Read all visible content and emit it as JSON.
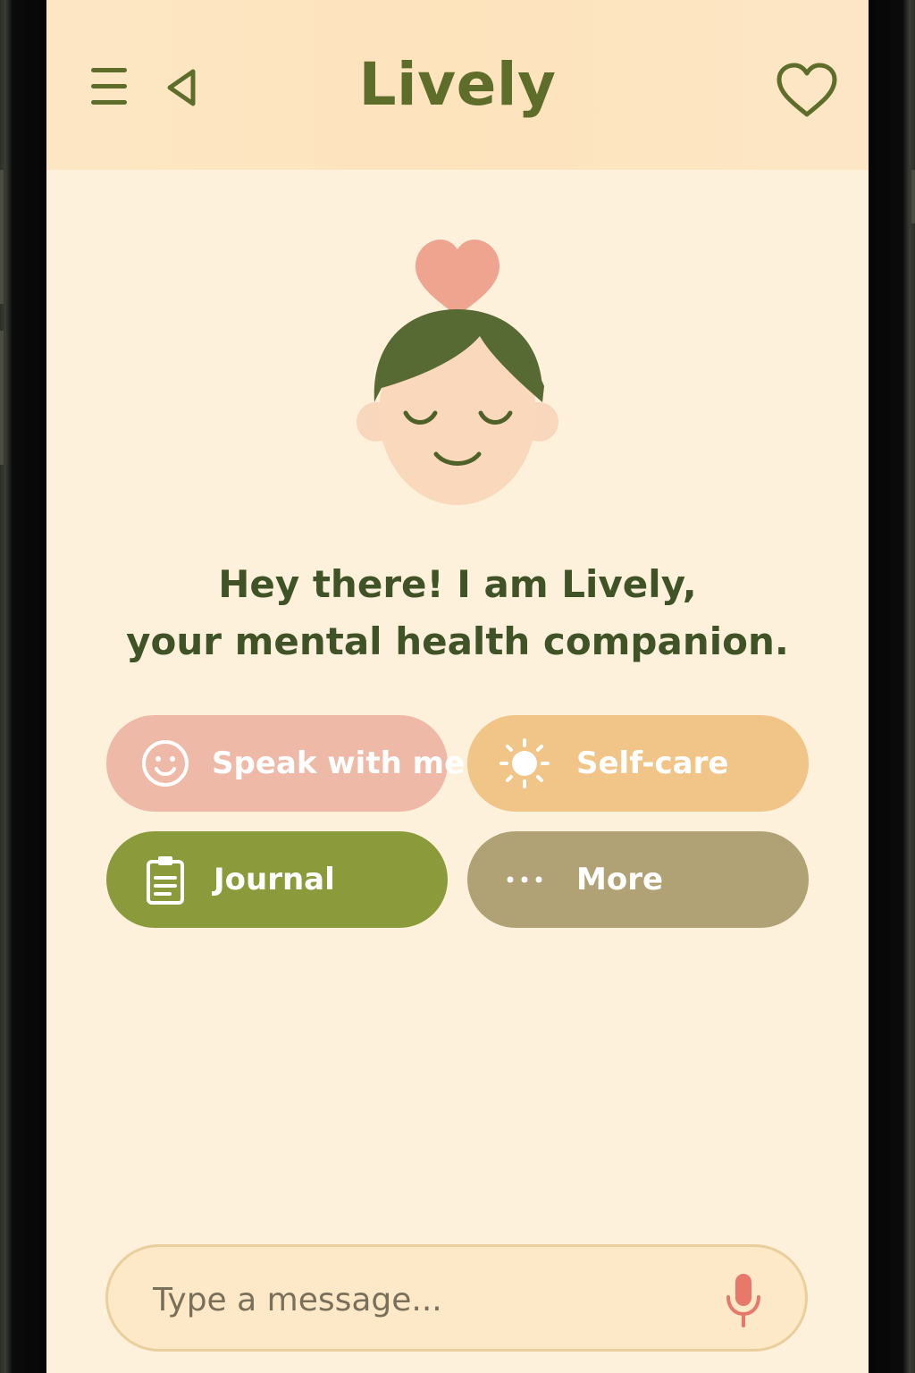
{
  "app": {
    "title": "Lively"
  },
  "header": {
    "menu_icon": "hamburger-menu-icon",
    "back_icon": "back-triangle-icon",
    "favorite_icon": "heart-outline-icon"
  },
  "greeting": {
    "line1": "Hey there! I am Lively,",
    "line2": "your mental health companion."
  },
  "actions": [
    {
      "label": "Speak with me",
      "icon": "smiley-face-icon",
      "color": "#efb9a8"
    },
    {
      "label": "Self-care",
      "icon": "sun-icon",
      "color": "#f1c488"
    },
    {
      "label": "Journal",
      "icon": "clipboard-icon",
      "color": "#8b9b3b"
    },
    {
      "label": "More",
      "icon": "ellipsis-icon",
      "color": "#b0a274"
    }
  ],
  "composer": {
    "placeholder": "Type a message...",
    "mic_icon": "microphone-icon"
  },
  "colors": {
    "background": "#fdf1dc",
    "header": "#fde4bd",
    "brand_olive": "#5e6d2a",
    "heading_green": "#3f5326",
    "accent_pink": "#eea48f",
    "mic_red": "#e8796a"
  }
}
